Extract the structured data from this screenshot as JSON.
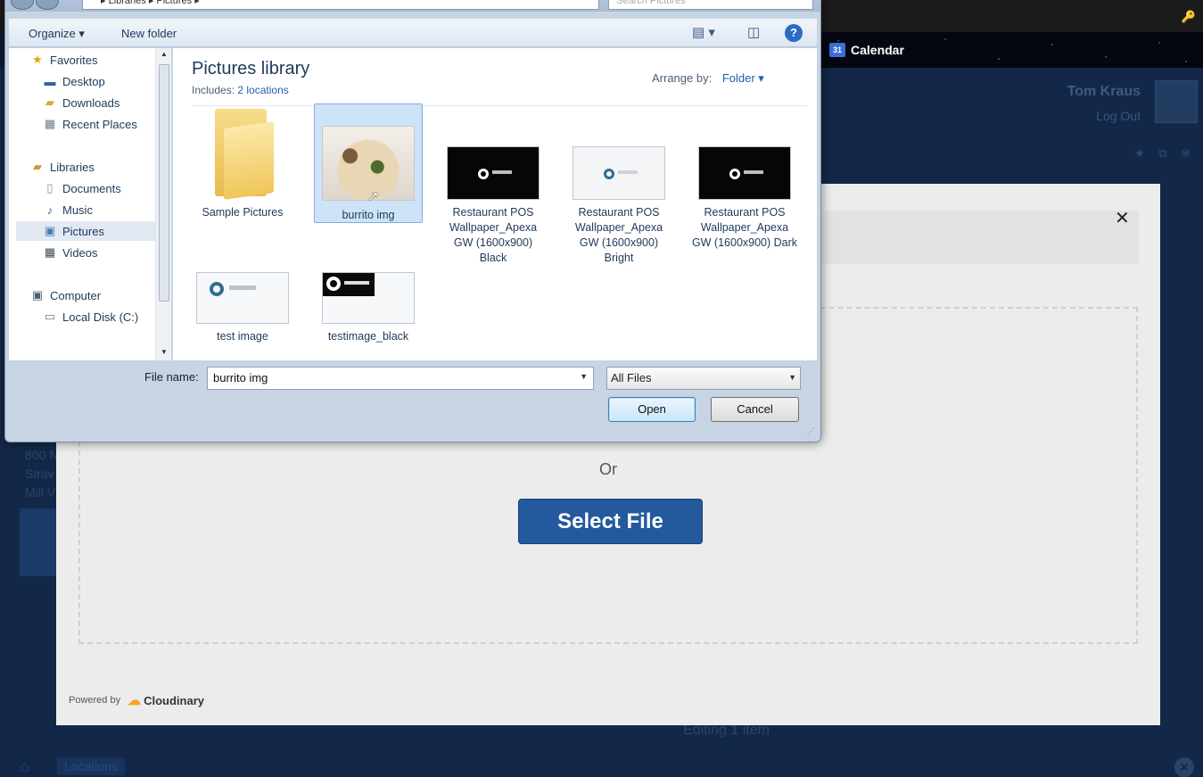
{
  "background_app": {
    "calendar_label": "Calendar",
    "calendar_icon_text": "31",
    "user_name": "Tom Kraus",
    "logout_label": "Log Out",
    "address_lines": [
      "800 N",
      "Strav",
      "Mill V"
    ],
    "status_text": "Editing 1 item",
    "locations_tab": "Locations"
  },
  "upload_widget": {
    "or_text": "Or",
    "select_file_label": "Select File",
    "powered_by": "Powered by",
    "brand": "Cloudinary",
    "accent_color": "#23599d"
  },
  "dialog": {
    "address_path": "▸ Libraries ▸ Pictures ▸",
    "search_placeholder": "Search Pictures",
    "toolbar": {
      "organize_label": "Organize ▾",
      "new_folder_label": "New folder"
    },
    "nav": {
      "favorites": "Favorites",
      "desktop": "Desktop",
      "downloads": "Downloads",
      "recent_places": "Recent Places",
      "libraries": "Libraries",
      "documents": "Documents",
      "music": "Music",
      "pictures": "Pictures",
      "videos": "Videos",
      "computer": "Computer",
      "local_disk": "Local Disk (C:)"
    },
    "library": {
      "title": "Pictures library",
      "includes_label": "Includes:",
      "includes_link": "2 locations",
      "arrange_label": "Arrange by:",
      "arrange_value": "Folder ▾"
    },
    "files": [
      {
        "name": "Sample Pictures"
      },
      {
        "name": "burrito img"
      },
      {
        "name": "Restaurant POS Wallpaper_Apexa GW (1600x900) Black"
      },
      {
        "name": "Restaurant POS Wallpaper_Apexa GW (1600x900) Bright"
      },
      {
        "name": "Restaurant POS Wallpaper_Apexa GW (1600x900) Dark"
      },
      {
        "name": "test image"
      },
      {
        "name": "testimage_black"
      }
    ],
    "file_name_label": "File name:",
    "file_name_value": "burrito img",
    "file_type_value": "All Files",
    "open_label": "Open",
    "cancel_label": "Cancel"
  }
}
